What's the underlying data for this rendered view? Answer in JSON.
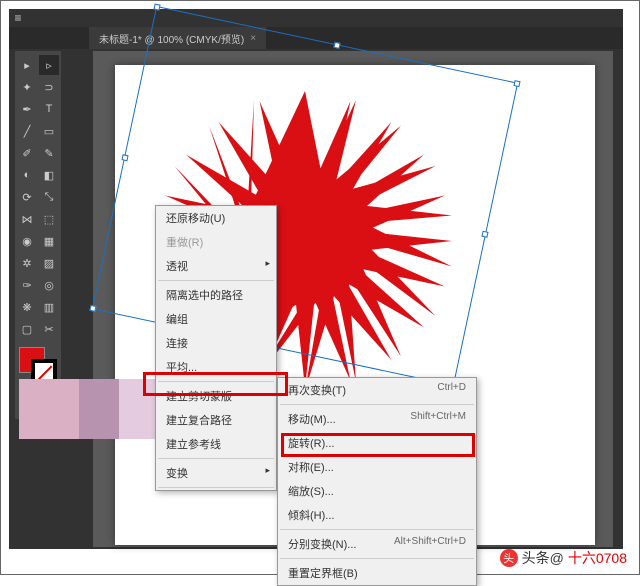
{
  "tab": {
    "title": "未标题-1* @ 100% (CMYK/预览)",
    "close": "×"
  },
  "colors": {
    "fill": "#d90f14",
    "stroke": "none"
  },
  "context_menu": {
    "items": [
      {
        "label": "还原移动(U)",
        "disabled": false
      },
      {
        "label": "重做(R)",
        "disabled": true
      },
      {
        "label": "透视",
        "has_sub": true
      },
      {
        "sep": true
      },
      {
        "label": "隔离选中的路径",
        "disabled": false
      },
      {
        "label": "编组",
        "disabled": false
      },
      {
        "label": "连接",
        "disabled": false
      },
      {
        "label": "平均...",
        "disabled": false
      },
      {
        "sep": true
      },
      {
        "label": "建立剪切蒙版",
        "disabled": false
      },
      {
        "label": "建立复合路径",
        "disabled": false
      },
      {
        "label": "建立参考线",
        "disabled": false
      },
      {
        "sep": true
      },
      {
        "label": "变换",
        "has_sub": true,
        "highlighted": true
      },
      {
        "sep": true
      }
    ]
  },
  "submenu": {
    "items": [
      {
        "label": "再次变换(T)",
        "shortcut": "Ctrl+D"
      },
      {
        "sep": true
      },
      {
        "label": "移动(M)...",
        "shortcut": "Shift+Ctrl+M"
      },
      {
        "label": "旋转(R)...",
        "shortcut": ""
      },
      {
        "label": "对称(E)...",
        "shortcut": ""
      },
      {
        "label": "缩放(S)...",
        "shortcut": "",
        "highlighted": true
      },
      {
        "label": "倾斜(H)...",
        "shortcut": ""
      },
      {
        "sep": true
      },
      {
        "label": "分别变换(N)...",
        "shortcut": "Alt+Shift+Ctrl+D"
      },
      {
        "sep": true
      },
      {
        "label": "重置定界框(B)",
        "shortcut": ""
      }
    ]
  },
  "credit": {
    "prefix": "头条@",
    "name": "十六0708"
  }
}
